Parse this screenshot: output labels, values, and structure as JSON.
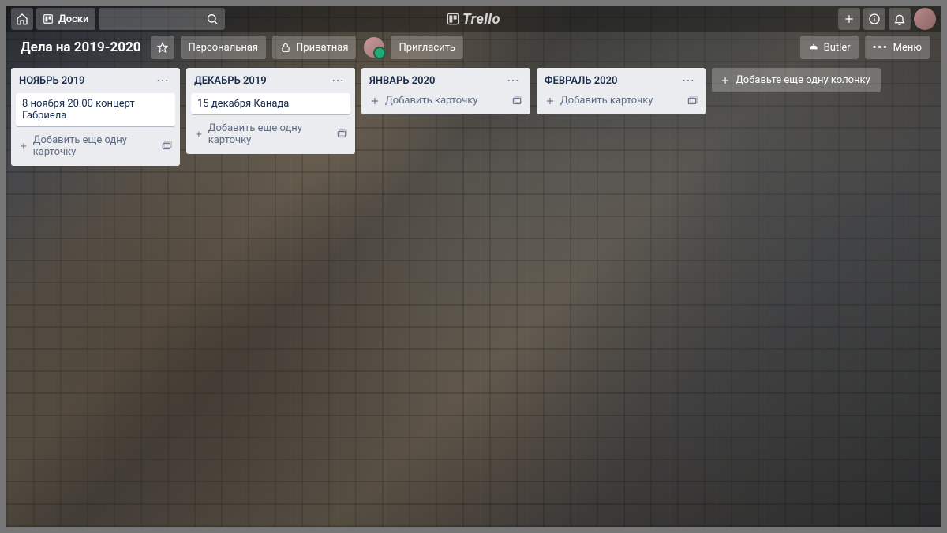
{
  "brand": "Trello",
  "topbar": {
    "boards_label": "Доски",
    "butler_label": "Butler"
  },
  "boardbar": {
    "title": "Дела на 2019-2020",
    "team_label": "Персональная",
    "privacy_label": "Приватная",
    "invite_label": "Пригласить",
    "menu_label": "Меню"
  },
  "lists": [
    {
      "title": "НОЯБРЬ 2019",
      "cards": [
        "8 ноября 20.00 концерт Габриела"
      ],
      "add_label": "Добавить еще одну карточку"
    },
    {
      "title": "ДЕКАБРЬ 2019",
      "cards": [
        "15 декабря Канада"
      ],
      "add_label": "Добавить еще одну карточку"
    },
    {
      "title": "ЯНВАРЬ 2020",
      "cards": [],
      "add_label": "Добавить карточку"
    },
    {
      "title": "ФЕВРАЛЬ 2020",
      "cards": [],
      "add_label": "Добавить карточку"
    }
  ],
  "add_list_label": "Добавьте еще одну колонку"
}
